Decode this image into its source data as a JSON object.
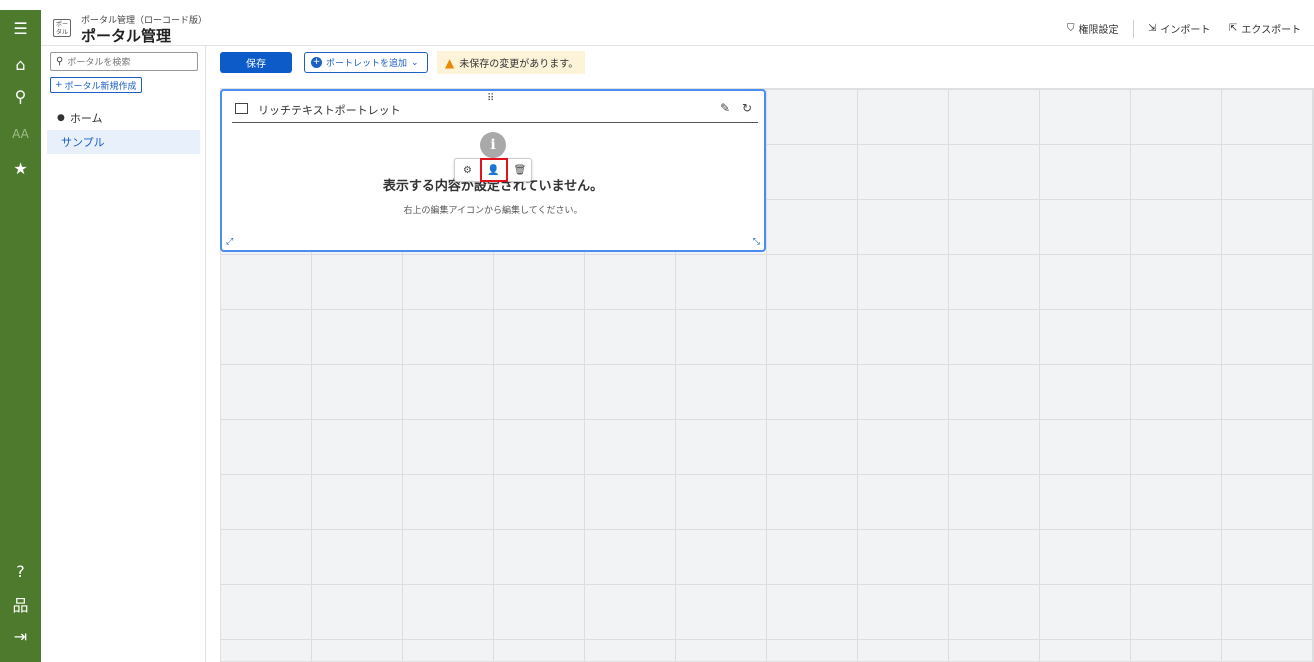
{
  "header": {
    "app_subtitle": "ポータル管理（ローコード版）",
    "app_title": "ポータル管理",
    "app_icon_text": "ポー\nタル",
    "permission_label": "権限設定",
    "import_label": "インポート",
    "export_label": "エクスポート"
  },
  "rail": {
    "icons": [
      "menu-icon",
      "home-icon",
      "search-icon",
      "font-size-icon",
      "star-icon",
      "help-icon",
      "sitemap-icon",
      "logout-icon"
    ]
  },
  "sidebar": {
    "search_placeholder": "ポータルを検索",
    "new_portal_label": "ポータル新規作成",
    "items": [
      {
        "label": "ホーム"
      },
      {
        "label": "サンプル"
      }
    ]
  },
  "toolbar": {
    "save_label": "保存",
    "add_portlet_label": "ポートレットを追加",
    "unsaved_warning": "未保存の変更があります。"
  },
  "portlet": {
    "title": "リッチテキストポートレット",
    "empty_message": "表示する内容が設定されていません。",
    "hint": "右上の編集アイコンから編集してください。"
  },
  "colors": {
    "rail_bg": "#4e7a2e",
    "primary": "#0d5ac9",
    "selection_border": "#4c8df0",
    "highlight": "#e0141e",
    "warning_bg": "#fcf3d9"
  }
}
